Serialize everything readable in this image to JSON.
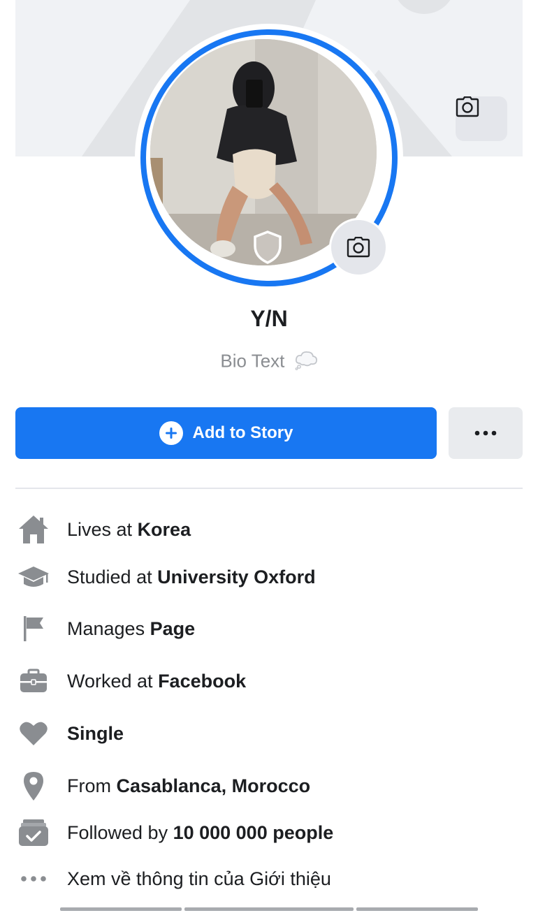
{
  "profile": {
    "name": "Y/N",
    "bio": "Bio Text"
  },
  "actions": {
    "add_story_label": "Add to Story",
    "more_label": "•••"
  },
  "intro": [
    {
      "icon": "home-icon",
      "prefix": "Lives at ",
      "value": "Korea"
    },
    {
      "icon": "graduation-cap-icon",
      "prefix": "Studied at ",
      "value": "University Oxford"
    },
    {
      "icon": "flag-icon",
      "prefix": "Manages ",
      "value": "Page"
    },
    {
      "icon": "briefcase-icon",
      "prefix": "Worked at ",
      "value": "Facebook"
    },
    {
      "icon": "heart-icon",
      "prefix": "",
      "value": "Single"
    },
    {
      "icon": "location-pin-icon",
      "prefix": "From ",
      "value": "Casablanca, Morocco"
    },
    {
      "icon": "followers-icon",
      "prefix": "Followed by ",
      "value": "10 000 000 people"
    },
    {
      "icon": "more-dots-icon",
      "prefix": "Xem về thông tin của Giới thiệu",
      "value": ""
    }
  ],
  "colors": {
    "accent": "#1877f2",
    "icon_gray": "#8a8d91",
    "surface": "#e4e6eb"
  }
}
